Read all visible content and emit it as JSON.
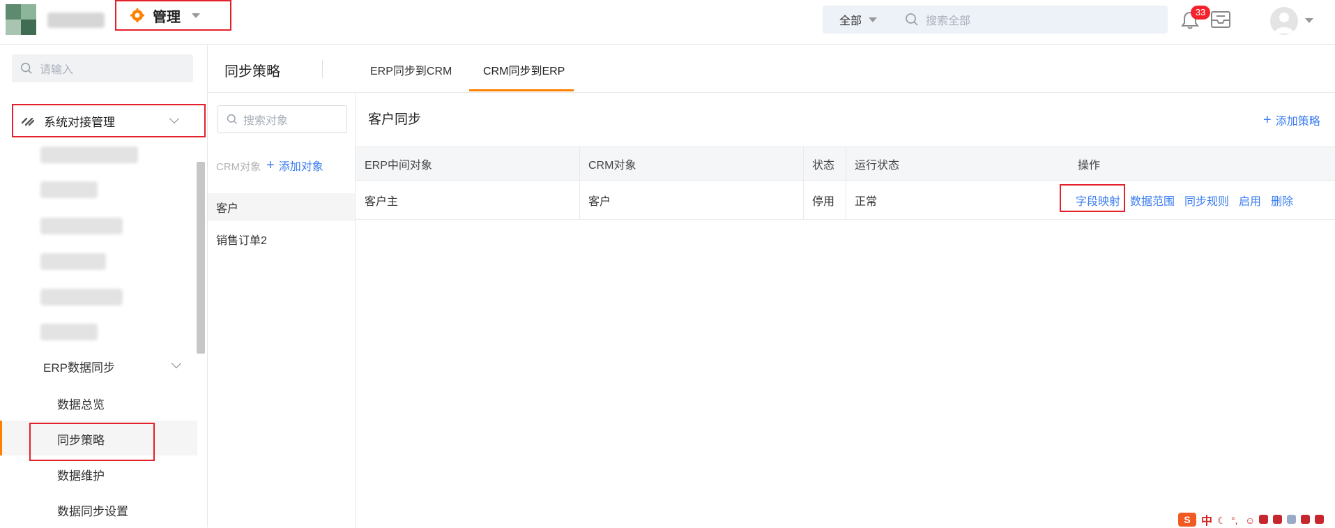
{
  "topbar": {
    "module_label": "管理",
    "search_scope": "全部",
    "search_placeholder": "搜索全部",
    "notification_count": "33"
  },
  "sidebar": {
    "search_placeholder": "请输入",
    "system_group_label": "系统对接管理",
    "erp_group_label": "ERP数据同步",
    "items": [
      {
        "label": "数据总览"
      },
      {
        "label": "同步策略"
      },
      {
        "label": "数据维护"
      },
      {
        "label": "数据同步设置"
      }
    ]
  },
  "main": {
    "page_title": "同步策略",
    "tabs": [
      {
        "label": "ERP同步到CRM"
      },
      {
        "label": "CRM同步到ERP"
      }
    ],
    "object_panel": {
      "search_placeholder": "搜索对象",
      "crm_object_label": "CRM对象",
      "add_object_label": "添加对象",
      "objects": [
        {
          "label": "客户"
        },
        {
          "label": "销售订单2"
        }
      ]
    },
    "section_title": "客户同步",
    "add_policy_label": "添加策略",
    "table": {
      "headers": [
        "ERP中间对象",
        "CRM对象",
        "状态",
        "运行状态",
        "操作"
      ],
      "rows": [
        {
          "erp_object": "客户主",
          "crm_object": "客户",
          "status": "停用",
          "run_status": "正常",
          "actions": [
            "字段映射",
            "数据范围",
            "同步规则",
            "启用",
            "删除"
          ]
        }
      ]
    }
  },
  "ime": {
    "lang": "中"
  },
  "colors": {
    "accent": "#ff8000",
    "link": "#3a7df0",
    "highlight_box": "#e4202b"
  }
}
